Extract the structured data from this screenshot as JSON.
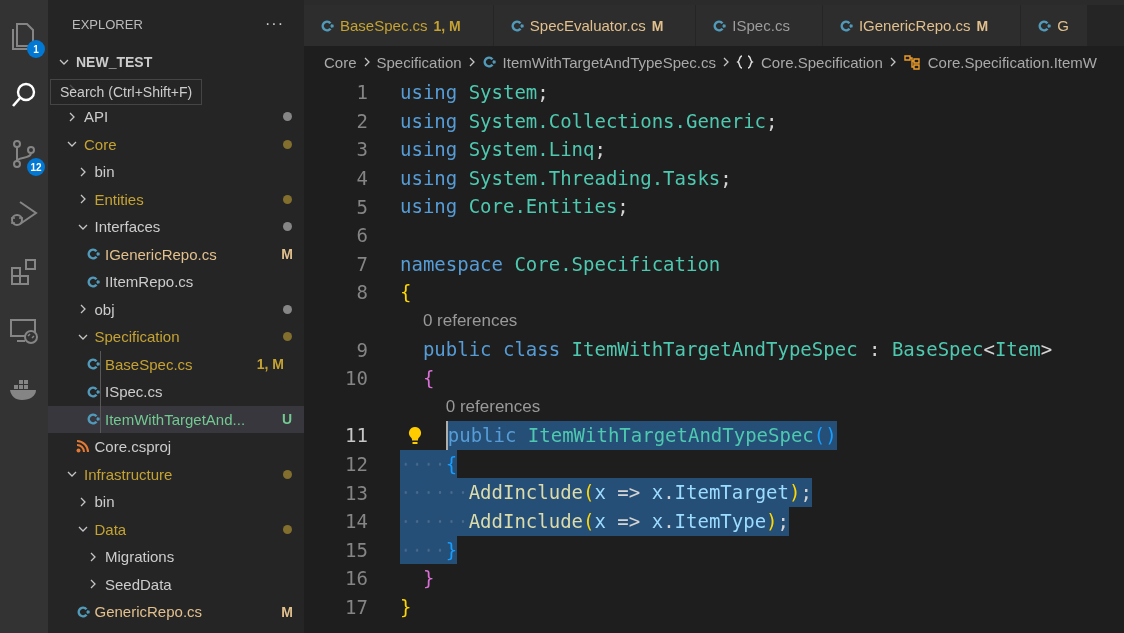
{
  "activity_bar": {
    "items": [
      {
        "kind": "explorer",
        "badge": "1",
        "selected": false
      },
      {
        "kind": "search",
        "selected": true
      },
      {
        "kind": "source_control",
        "badge": "12",
        "selected": false
      },
      {
        "kind": "run_debug",
        "selected": false
      },
      {
        "kind": "extensions",
        "selected": false
      },
      {
        "kind": "remote",
        "selected": false
      },
      {
        "kind": "docker",
        "selected": false
      }
    ],
    "tooltip": "Search (Ctrl+Shift+F)"
  },
  "sidebar": {
    "title": "EXPLORER",
    "more": "···",
    "root": {
      "label": "NEW_TEST",
      "expanded": true
    },
    "items": [
      {
        "kind": "folder",
        "expanded": false,
        "selected": false
      },
      {
        "label": "API",
        "kind": "folder",
        "expanded": false,
        "selected": false,
        "color": "#cccccc",
        "dot": true
      },
      {
        "label": "Core",
        "kind": "folder",
        "expanded": true,
        "selected": false,
        "color": "#c5a332",
        "dot": true,
        "children": [
          {
            "label": "bin",
            "kind": "folder",
            "expanded": false,
            "selected": false
          },
          {
            "label": "Entities",
            "kind": "folder",
            "expanded": false,
            "selected": false,
            "color": "#c5a332",
            "dot": true
          },
          {
            "label": "Interfaces",
            "kind": "folder",
            "expanded": true,
            "selected": false,
            "color": "#cccccc",
            "dot": true,
            "children": [
              {
                "label": "IGenericRepo.cs",
                "kind": "csharp",
                "selected": false,
                "color": "#e2c08d",
                "badge": "M"
              },
              {
                "label": "IItemRepo.cs",
                "kind": "csharp",
                "selected": false
              }
            ]
          },
          {
            "label": "obj",
            "kind": "folder",
            "expanded": false,
            "selected": false,
            "dot": true
          },
          {
            "label": "Specification",
            "kind": "folder",
            "expanded": true,
            "selected": false,
            "color": "#c5a332",
            "dot": true,
            "children": [
              {
                "label": "BaseSpec.cs",
                "kind": "csharp",
                "selected": false,
                "color": "#c5a332",
                "badge": "1, M"
              },
              {
                "label": "ISpec.cs",
                "kind": "csharp",
                "selected": false
              },
              {
                "label": "ItemWithTargetAnd...",
                "kind": "csharp",
                "selected": true,
                "color": "#73c991",
                "badge": "U"
              }
            ]
          },
          {
            "label": "Core.csproj",
            "kind": "rss",
            "selected": false
          }
        ]
      },
      {
        "label": "Infrastructure",
        "kind": "folder",
        "expanded": true,
        "selected": false,
        "color": "#c5a332",
        "dot": true,
        "children": [
          {
            "label": "bin",
            "kind": "folder",
            "expanded": false,
            "selected": false
          },
          {
            "label": "Data",
            "kind": "folder",
            "expanded": true,
            "selected": false,
            "color": "#c5a332",
            "dot": true,
            "children": [
              {
                "label": "Migrations",
                "kind": "folder",
                "expanded": false,
                "selected": false
              },
              {
                "label": "SeedData",
                "kind": "folder",
                "expanded": false,
                "selected": false
              }
            ]
          },
          {
            "label": "GenericRepo.cs",
            "kind": "csharp",
            "selected": false,
            "color": "#e2c08d",
            "badge": "M"
          }
        ]
      }
    ]
  },
  "tabs": [
    {
      "label": "BaseSpec.cs",
      "badge": "1, M",
      "color": "#c5a332",
      "selected": false
    },
    {
      "label": "SpecEvaluator.cs",
      "badge": "M",
      "color": "#e2c08d",
      "selected": false
    },
    {
      "label": "ISpec.cs",
      "color": "#9d9d9d",
      "selected": false
    },
    {
      "label": "IGenericRepo.cs",
      "badge": "M",
      "color": "#e2c08d",
      "selected": false
    },
    {
      "label": "G",
      "color": "#e2c08d",
      "selected": false
    }
  ],
  "breadcrumbs": [
    {
      "label": "Core",
      "kind": "folder"
    },
    {
      "label": "Specification",
      "kind": "folder"
    },
    {
      "label": "ItemWithTargetAndTypeSpec.cs",
      "kind": "csharp"
    },
    {
      "label": "Core.Specification",
      "kind": "namespace"
    },
    {
      "label": "Core.Specification.ItemW",
      "kind": "class"
    }
  ],
  "code": [
    {
      "kind": "code",
      "number": "1",
      "selected": false,
      "tokens": [
        {
          "text": "using",
          "kind": "keyword"
        },
        {
          "text": " System",
          "kind": "type"
        },
        {
          "text": ";",
          "kind": "plain"
        }
      ]
    },
    {
      "kind": "code",
      "number": "2",
      "selected": false,
      "tokens": [
        {
          "text": "using",
          "kind": "keyword"
        },
        {
          "text": " System.Collections.Generic",
          "kind": "type"
        },
        {
          "text": ";",
          "kind": "plain"
        }
      ]
    },
    {
      "kind": "code",
      "number": "3",
      "selected": false,
      "tokens": [
        {
          "text": "using",
          "kind": "keyword"
        },
        {
          "text": " System.Linq",
          "kind": "type"
        },
        {
          "text": ";",
          "kind": "plain"
        }
      ]
    },
    {
      "kind": "code",
      "number": "4",
      "selected": false,
      "tokens": [
        {
          "text": "using",
          "kind": "keyword"
        },
        {
          "text": " System.Threading.Tasks",
          "kind": "type"
        },
        {
          "text": ";",
          "kind": "plain"
        }
      ]
    },
    {
      "kind": "code",
      "number": "5",
      "selected": false,
      "tokens": [
        {
          "text": "using",
          "kind": "keyword"
        },
        {
          "text": " Core.Entities",
          "kind": "type"
        },
        {
          "text": ";",
          "kind": "plain"
        }
      ]
    },
    {
      "kind": "code",
      "number": "6",
      "selected": false
    },
    {
      "kind": "code",
      "number": "7",
      "selected": false,
      "tokens": [
        {
          "text": "namespace",
          "kind": "keyword"
        },
        {
          "text": " Core.Specification",
          "kind": "type"
        }
      ]
    },
    {
      "kind": "code",
      "number": "8",
      "selected": false,
      "tokens": [
        {
          "text": "{",
          "kind": "bracket1"
        }
      ],
      "children": [
        {
          "kind": "codelens",
          "text": "0 references"
        },
        {
          "kind": "code",
          "number": "9",
          "selected": false,
          "tokens": [
            {
              "text": "public class",
              "kind": "keyword"
            },
            {
              "text": " ItemWithTargetAndTypeSpec",
              "kind": "type"
            },
            {
              "text": " : ",
              "kind": "plain"
            },
            {
              "text": "BaseSpec",
              "kind": "type"
            },
            {
              "text": "<",
              "kind": "plain"
            },
            {
              "text": "Item",
              "kind": "type"
            },
            {
              "text": ">",
              "kind": "plain"
            }
          ]
        },
        {
          "kind": "code",
          "number": "10",
          "selected": false,
          "tokens": [
            {
              "text": "{",
              "kind": "bracket2"
            }
          ],
          "children": [
            {
              "kind": "codelens",
              "text": "0 references"
            },
            {
              "kind": "code",
              "number": "11",
              "selected": true,
              "lightbulb": true,
              "current": true,
              "tokens": [
                {
                  "text": "public",
                  "kind": "keyword"
                },
                {
                  "text": " ItemWithTargetAndTypeSpec",
                  "kind": "type"
                },
                {
                  "text": "()",
                  "kind": "bracket3"
                }
              ]
            },
            {
              "kind": "code",
              "number": "12",
              "selected": true,
              "tokens": [
                {
                  "text": "{",
                  "kind": "bracket3"
                }
              ],
              "children": [
                {
                  "kind": "code",
                  "number": "13",
                  "selected": true,
                  "tokens": [
                    {
                      "text": "AddInclude",
                      "kind": "method"
                    },
                    {
                      "text": "(",
                      "kind": "bracket1"
                    },
                    {
                      "text": "x",
                      "kind": "variable"
                    },
                    {
                      "text": " => ",
                      "kind": "plain"
                    },
                    {
                      "text": "x",
                      "kind": "variable"
                    },
                    {
                      "text": ".",
                      "kind": "plain"
                    },
                    {
                      "text": "ItemTarget",
                      "kind": "variable"
                    },
                    {
                      "text": ")",
                      "kind": "bracket1"
                    },
                    {
                      "text": ";",
                      "kind": "plain"
                    }
                  ]
                },
                {
                  "kind": "code",
                  "number": "14",
                  "selected": true,
                  "tokens": [
                    {
                      "text": "AddInclude",
                      "kind": "method"
                    },
                    {
                      "text": "(",
                      "kind": "bracket1"
                    },
                    {
                      "text": "x",
                      "kind": "variable"
                    },
                    {
                      "text": " => ",
                      "kind": "plain"
                    },
                    {
                      "text": "x",
                      "kind": "variable"
                    },
                    {
                      "text": ".",
                      "kind": "plain"
                    },
                    {
                      "text": "ItemType",
                      "kind": "variable"
                    },
                    {
                      "text": ")",
                      "kind": "bracket1"
                    },
                    {
                      "text": ";",
                      "kind": "plain"
                    }
                  ]
                }
              ]
            },
            {
              "kind": "code",
              "number": "15",
              "selected": true,
              "tokens": [
                {
                  "text": "}",
                  "kind": "bracket3"
                }
              ]
            }
          ]
        },
        {
          "kind": "code",
          "number": "16",
          "selected": false,
          "tokens": [
            {
              "text": "}",
              "kind": "bracket2"
            }
          ]
        }
      ]
    },
    {
      "kind": "code",
      "number": "17",
      "selected": false,
      "tokens": [
        {
          "text": "}",
          "kind": "bracket1"
        }
      ]
    }
  ]
}
